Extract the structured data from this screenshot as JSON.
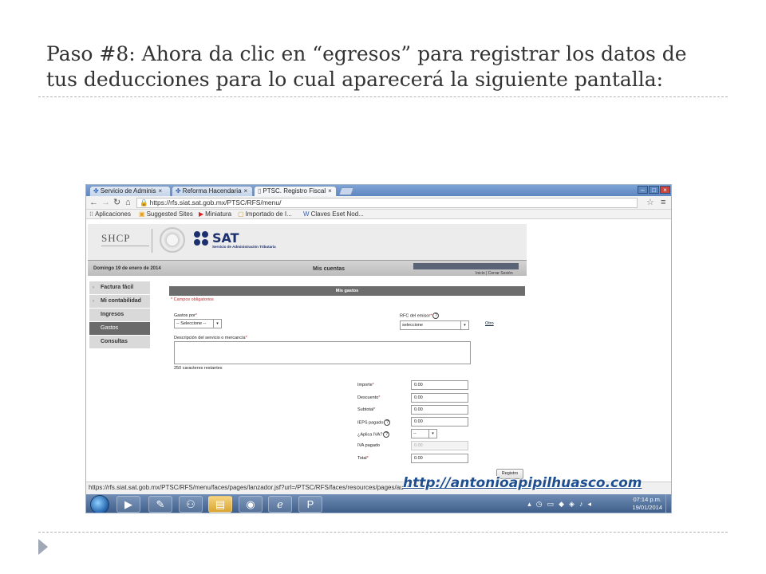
{
  "slide": {
    "title_line1": "Paso #8: Ahora da clic en “egresos” para registrar los datos de",
    "title_line2": "tus deducciones para lo cual aparecerá la siguiente pantalla:"
  },
  "browser": {
    "tabs": [
      {
        "label": "Servicio de Adminis",
        "close": "×"
      },
      {
        "label": "Reforma Hacendaria",
        "close": "×"
      },
      {
        "label": "PTSC. Registro Fiscal",
        "close": "×"
      }
    ],
    "window_buttons": [
      "–",
      "□",
      "×"
    ],
    "url": "https://rfs.siat.sat.gob.mx/PTSC/RFS/menu/",
    "bookmarks": [
      {
        "icon": "⁝⁝",
        "label": "Aplicaciones"
      },
      {
        "icon": "▣",
        "label": "Suggested Sites"
      },
      {
        "icon": "▶",
        "label": "Miniatura"
      },
      {
        "icon": "▢",
        "label": "Importado de I..."
      },
      {
        "icon": "W",
        "label": "Claves Eset Nod..."
      }
    ],
    "status_url": "https://rfs.siat.sat.gob.mx/PTSC/RFS/menu/faces/pages/lanzador.jsf?url=/PTSC/RFS/faces/resources/pages/autc"
  },
  "sat": {
    "shcp": "SHCP",
    "logo": "SAT",
    "logo_sub": "Servicio de Administración Tributaria",
    "date": "Domingo 19 de enero de 2014",
    "section_title": "Mis cuentas",
    "top_links": "Inicio | Cerrar Sesión",
    "sidebar": [
      "Factura fácil",
      "Mi contabilidad",
      "Ingresos",
      "Gastos",
      "Consultas"
    ],
    "form_title": "Mis gastos",
    "required_note": "* Campos obligatorios",
    "gastos_label": "Gastos por",
    "gastos_value": "-- Seleccione --",
    "rfc_label": "RFC del emisor",
    "rfc_value": "seleccione",
    "otro": "Otro",
    "desc_label": "Descripción del servicio o mercancía",
    "chars_left": "250 caracteres restantes",
    "fields": [
      {
        "label": "Importe",
        "value": "0.00"
      },
      {
        "label": "Descuento",
        "value": "0.00"
      },
      {
        "label": "Subtotal",
        "value": "0.00"
      },
      {
        "label": "IEPS pagado",
        "value": "0.00"
      },
      {
        "label": "¿Aplica IVA?",
        "value": "--"
      },
      {
        "label": "IVA pagado",
        "value": "0.00"
      },
      {
        "label": "Total",
        "value": "0.00"
      }
    ],
    "button": "Registro"
  },
  "taskbar": {
    "time": "07:14 p.m.",
    "date": "19/01/2014"
  },
  "watermark": "http://antonioapipilhuasco.com"
}
